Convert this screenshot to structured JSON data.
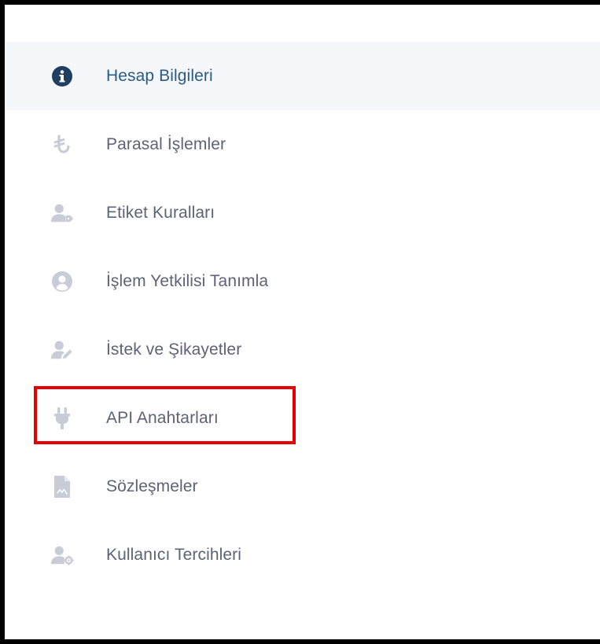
{
  "menu": {
    "items": [
      {
        "label": "Hesap Bilgileri",
        "icon": "info-circle-icon",
        "active": true
      },
      {
        "label": "Parasal İşlemler",
        "icon": "lira-icon",
        "active": false
      },
      {
        "label": "Etiket Kuralları",
        "icon": "user-tag-icon",
        "active": false
      },
      {
        "label": "İşlem Yetkilisi Tanımla",
        "icon": "user-circle-icon",
        "active": false
      },
      {
        "label": "İstek ve Şikayetler",
        "icon": "user-edit-icon",
        "active": false
      },
      {
        "label": "API Anahtarları",
        "icon": "plug-icon",
        "active": false
      },
      {
        "label": "Sözleşmeler",
        "icon": "document-icon",
        "active": false
      },
      {
        "label": "Kullanıcı Tercihleri",
        "icon": "user-gear-icon",
        "active": false
      }
    ]
  },
  "colors": {
    "active_text": "#2a5a86",
    "active_icon": "#1f3f62",
    "inactive_text": "#5d6276",
    "inactive_icon": "#c9ccd6",
    "active_background": "#f6f7fa",
    "highlight": "#e80000"
  }
}
